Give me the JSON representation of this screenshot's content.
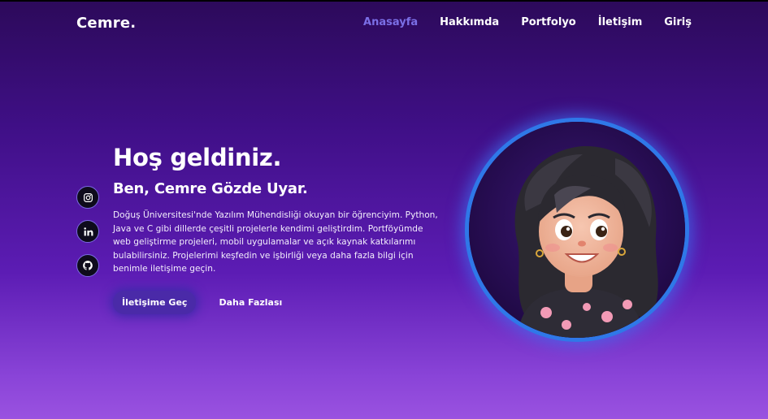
{
  "brand": {
    "logo": "Cemre."
  },
  "nav": {
    "items": [
      {
        "label": "Anasayfa",
        "active": true
      },
      {
        "label": "Hakkımda",
        "active": false
      },
      {
        "label": "Portfolyo",
        "active": false
      },
      {
        "label": "İletişim",
        "active": false
      },
      {
        "label": "Giriş",
        "active": false
      }
    ]
  },
  "hero": {
    "title": "Hoş geldiniz.",
    "subtitle": "Ben, Cemre Gözde Uyar.",
    "bio_lines": [
      "Doğuş Üniversitesi'nde Yazılım Mühendisliği okuyan bir öğrenciyim. Python,",
      "Java ve C gibi dillerde çeşitli projelerle kendimi geliştirdim. Portföyümde",
      "web geliştirme projeleri, mobil uygulamalar ve açık kaynak katkılarımı",
      "bulabilirsiniz. Projelerimi keşfedin ve işbirliği veya daha fazla bilgi için",
      "benimle iletişime geçin."
    ],
    "primary_button": "İletişime Geç",
    "secondary_button": "Daha Fazlası"
  },
  "socials": [
    {
      "icon": "instagram-icon"
    },
    {
      "icon": "linkedin-icon"
    },
    {
      "icon": "github-icon"
    }
  ],
  "colors": {
    "accent": "#7b6fe6",
    "avatar_ring": "#2f78e8",
    "button_bg": "#4a2aa8",
    "bg_top": "#2c0a5a",
    "bg_bottom": "#9a52e0"
  }
}
